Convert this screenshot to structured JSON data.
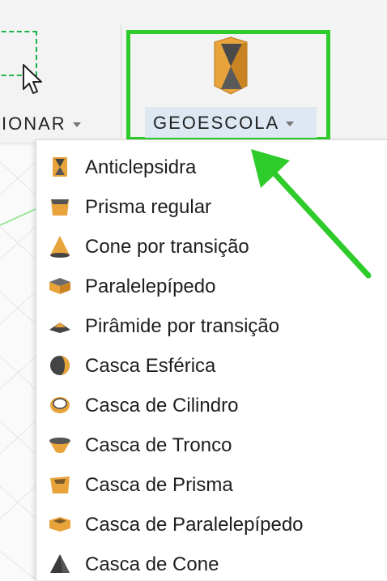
{
  "toolbar": {
    "selecionar_label": "IONAR",
    "geoescola_label": "GEOESCOLA"
  },
  "menu": {
    "items": [
      {
        "label": "Anticlepsidra",
        "icon": "anticlepsidra-icon"
      },
      {
        "label": "Prisma regular",
        "icon": "prisma-regular-icon"
      },
      {
        "label": "Cone por transição",
        "icon": "cone-icon"
      },
      {
        "label": "Paralelepípedo",
        "icon": "paralelepipedo-icon"
      },
      {
        "label": "Pirâmide por transição",
        "icon": "piramide-icon"
      },
      {
        "label": "Casca Esférica",
        "icon": "casca-esferica-icon"
      },
      {
        "label": "Casca de Cilindro",
        "icon": "casca-cilindro-icon"
      },
      {
        "label": "Casca de Tronco",
        "icon": "casca-tronco-icon"
      },
      {
        "label": "Casca de Prisma",
        "icon": "casca-prisma-icon"
      },
      {
        "label": "Casca de Paralelepípedo",
        "icon": "casca-paralelepipedo-icon"
      },
      {
        "label": "Casca de Cone",
        "icon": "casca-cone-icon"
      }
    ]
  },
  "colors": {
    "highlight": "#2ecc2a",
    "shape_gold": "#e8a33a",
    "shape_dark": "#3d3d3d"
  }
}
